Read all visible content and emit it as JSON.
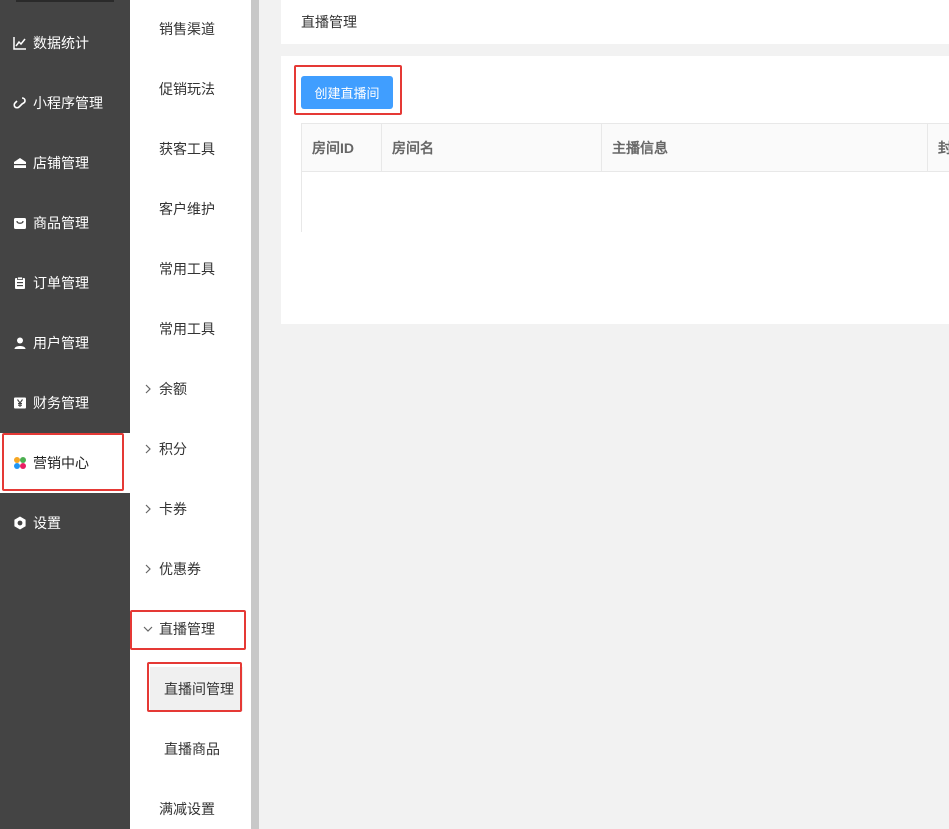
{
  "nav1": {
    "items": [
      {
        "label": "数据统计",
        "icon": "chart-line-icon"
      },
      {
        "label": "小程序管理",
        "icon": "link-icon"
      },
      {
        "label": "店铺管理",
        "icon": "store-icon"
      },
      {
        "label": "商品管理",
        "icon": "bag-icon"
      },
      {
        "label": "订单管理",
        "icon": "clipboard-icon"
      },
      {
        "label": "用户管理",
        "icon": "user-icon"
      },
      {
        "label": "财务管理",
        "icon": "yuan-icon"
      },
      {
        "label": "营销中心",
        "icon": "marketing-icon",
        "active": true
      },
      {
        "label": "设置",
        "icon": "settings-icon"
      }
    ]
  },
  "nav2": {
    "items": [
      {
        "label": "销售渠道"
      },
      {
        "label": "促销玩法"
      },
      {
        "label": "获客工具"
      },
      {
        "label": "客户维护"
      },
      {
        "label": "常用工具"
      },
      {
        "label": "常用工具"
      },
      {
        "label": "余额",
        "expandable": true
      },
      {
        "label": "积分",
        "expandable": true
      },
      {
        "label": "卡券",
        "expandable": true
      },
      {
        "label": "优惠券",
        "expandable": true
      },
      {
        "label": "直播管理",
        "expandable": true,
        "expanded": true
      }
    ],
    "sub_items": [
      {
        "label": "直播间管理",
        "active": true
      },
      {
        "label": "直播商品"
      }
    ],
    "last_item": {
      "label": "满减设置"
    }
  },
  "header": {
    "title": "直播管理"
  },
  "panel": {
    "create_button": "创建直播间",
    "table": {
      "columns": [
        "房间ID",
        "房间名",
        "主播信息",
        "封"
      ],
      "rows": []
    }
  },
  "colors": {
    "nav_bg": "#444444",
    "accent_button": "#409eff",
    "highlight_box": "#e53935"
  }
}
